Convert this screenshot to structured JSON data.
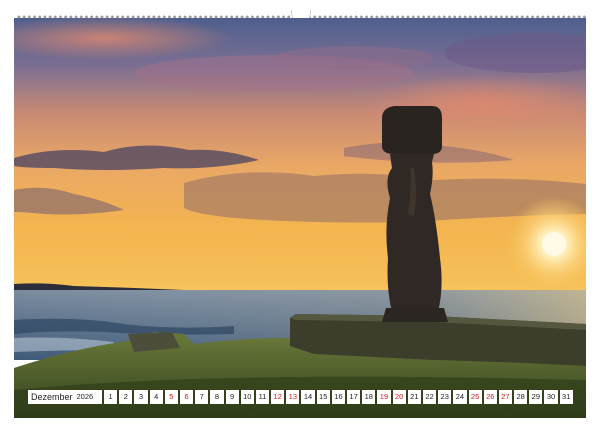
{
  "calendar": {
    "month": "Dezember",
    "year": "2026",
    "days": [
      {
        "n": "1",
        "red": false
      },
      {
        "n": "2",
        "red": false
      },
      {
        "n": "3",
        "red": false
      },
      {
        "n": "4",
        "red": false
      },
      {
        "n": "5",
        "red": true
      },
      {
        "n": "6",
        "red": true
      },
      {
        "n": "7",
        "red": false
      },
      {
        "n": "8",
        "red": false
      },
      {
        "n": "9",
        "red": false
      },
      {
        "n": "10",
        "red": false
      },
      {
        "n": "11",
        "red": false
      },
      {
        "n": "12",
        "red": true
      },
      {
        "n": "13",
        "red": true
      },
      {
        "n": "14",
        "red": false
      },
      {
        "n": "15",
        "red": false
      },
      {
        "n": "16",
        "red": false
      },
      {
        "n": "17",
        "red": false
      },
      {
        "n": "18",
        "red": false
      },
      {
        "n": "19",
        "red": true
      },
      {
        "n": "20",
        "red": true
      },
      {
        "n": "21",
        "red": false
      },
      {
        "n": "22",
        "red": false
      },
      {
        "n": "23",
        "red": false
      },
      {
        "n": "24",
        "red": false
      },
      {
        "n": "25",
        "red": true
      },
      {
        "n": "26",
        "red": true
      },
      {
        "n": "27",
        "red": true
      },
      {
        "n": "28",
        "red": false
      },
      {
        "n": "29",
        "red": false
      },
      {
        "n": "30",
        "red": false
      },
      {
        "n": "31",
        "red": false
      }
    ]
  },
  "colors": {
    "weekend": "#d11d1d",
    "weekday": "#1f1f1f"
  },
  "icons": {
    "binding": "wire-binding-icon",
    "hanger": "hanger-hole-icon"
  }
}
